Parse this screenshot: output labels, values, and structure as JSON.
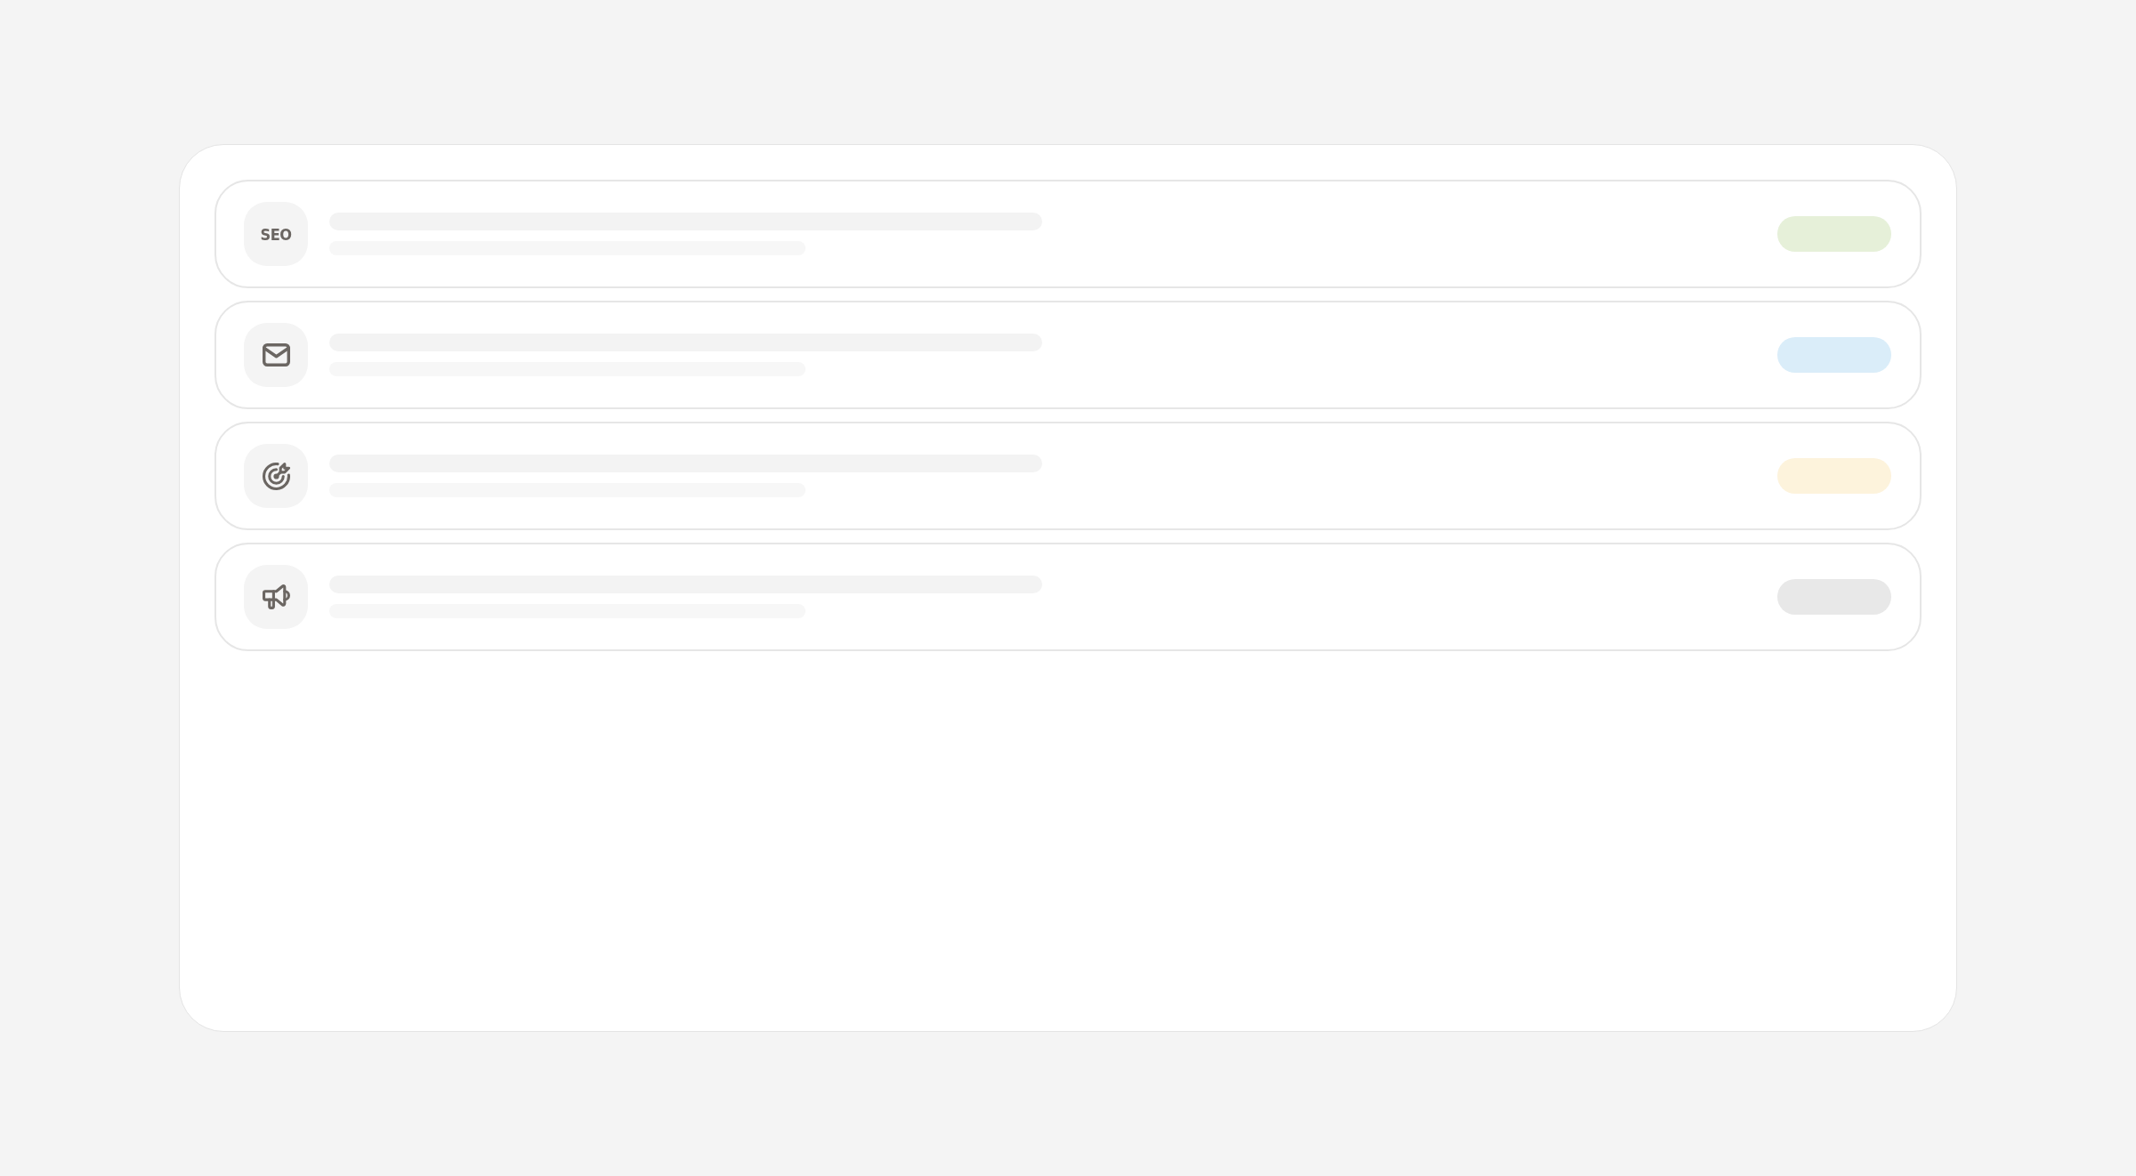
{
  "rows": [
    {
      "kind": "text",
      "label": "SEO",
      "color": "#e6f0d9"
    },
    {
      "kind": "mail",
      "color": "#daedf9"
    },
    {
      "kind": "target",
      "color": "#fdf3dc"
    },
    {
      "kind": "megaphone",
      "color": "#e8e8e8"
    }
  ]
}
